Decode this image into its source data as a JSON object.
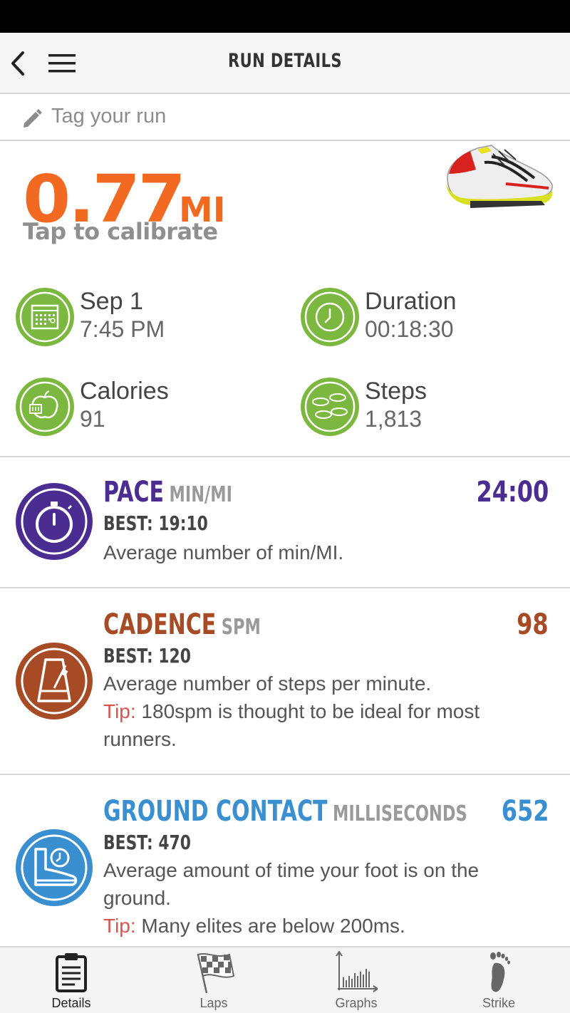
{
  "header": {
    "title": "RUN DETAILS"
  },
  "tag": {
    "placeholder": "Tag your run"
  },
  "distance": {
    "value": "0.77",
    "unit": "MI",
    "calibrate_label": "Tap to calibrate"
  },
  "stats": {
    "date": {
      "label": "Sep 1",
      "value": "7:45 PM",
      "icon": "calendar-icon"
    },
    "duration": {
      "label": "Duration",
      "value": "00:18:30",
      "icon": "clock-icon"
    },
    "calories": {
      "label": "Calories",
      "value": "91",
      "icon": "apple-scale-icon"
    },
    "steps": {
      "label": "Steps",
      "value": "1,813",
      "icon": "footprints-icon"
    }
  },
  "metrics": {
    "pace": {
      "title": "PACE",
      "unit": "MIN/MI",
      "value": "24:00",
      "best": "BEST: 19:10",
      "description": "Average number of min/MI.",
      "color": "#4b2c91"
    },
    "cadence": {
      "title": "CADENCE",
      "unit": "SPM",
      "value": "98",
      "best": "BEST: 120",
      "description": "Average number of steps per minute.",
      "tip_label": "Tip:",
      "tip_text": " 180spm is thought to be ideal for most runners.",
      "color": "#a64b26"
    },
    "ground_contact": {
      "title": "GROUND CONTACT",
      "unit": "MILLISECONDS",
      "value": "652",
      "best": "BEST: 470",
      "description": "Average amount of time your foot is on the ground.",
      "tip_label": "Tip:",
      "tip_text": " Many elites are below 200ms.",
      "color": "#3a8fd0"
    }
  },
  "tabs": [
    {
      "label": "Details",
      "icon": "clipboard-icon",
      "active": true
    },
    {
      "label": "Laps",
      "icon": "checkered-flag-icon",
      "active": false
    },
    {
      "label": "Graphs",
      "icon": "bar-graph-icon",
      "active": false
    },
    {
      "label": "Strike",
      "icon": "footprint-icon",
      "active": false
    }
  ],
  "colors": {
    "accent_orange": "#f26a21",
    "green": "#7cb83f",
    "pace_purple": "#4b2c91",
    "cadence_brown": "#a64b26",
    "ground_blue": "#3a8fd0",
    "tip_red": "#d9534f"
  }
}
